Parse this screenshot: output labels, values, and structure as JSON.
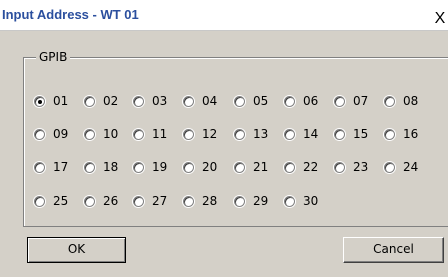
{
  "window": {
    "title": "Input Address - WT 01",
    "close_glyph": "X"
  },
  "group": {
    "label": "GPIB",
    "options": [
      "01",
      "02",
      "03",
      "04",
      "05",
      "06",
      "07",
      "08",
      "09",
      "10",
      "11",
      "12",
      "13",
      "14",
      "15",
      "16",
      "17",
      "18",
      "19",
      "20",
      "21",
      "22",
      "23",
      "24",
      "25",
      "26",
      "27",
      "28",
      "29",
      "30"
    ],
    "selected": "01"
  },
  "buttons": {
    "ok_label": "OK",
    "cancel_label": "Cancel"
  },
  "colors": {
    "dialog_bg": "#d4d0c8",
    "title_text": "#2b4f9e"
  }
}
